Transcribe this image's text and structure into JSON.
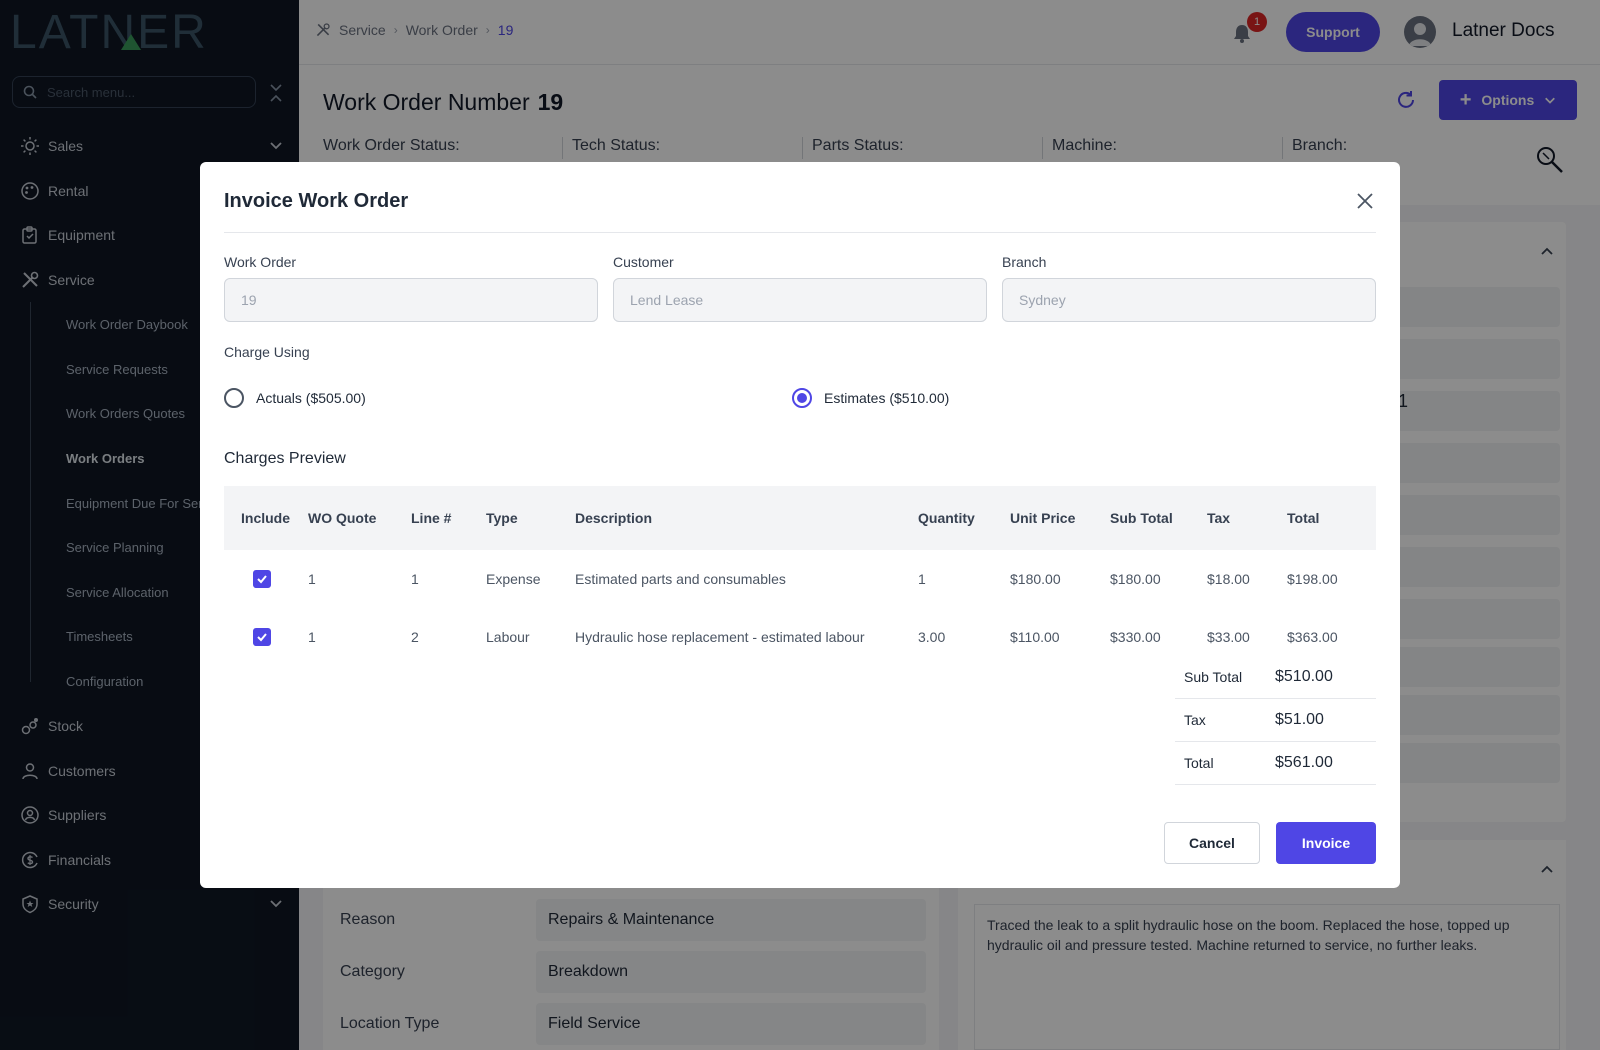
{
  "brand": {
    "logo_text": "LATNER"
  },
  "sidebar": {
    "search_placeholder": "Search menu...",
    "items": [
      {
        "label": "Sales",
        "icon": "sun-icon",
        "expandable": true
      },
      {
        "label": "Rental",
        "icon": "palette-icon"
      },
      {
        "label": "Equipment",
        "icon": "clipboard-icon"
      },
      {
        "label": "Service",
        "icon": "tools-icon"
      }
    ],
    "service_sub": [
      "Work Order Daybook",
      "Service Requests",
      "Work Orders Quotes",
      "Work Orders",
      "Equipment Due For Service",
      "Service Planning",
      "Service Allocation",
      "Timesheets",
      "Configuration"
    ],
    "items_after": [
      {
        "label": "Stock",
        "icon": "boxes-icon"
      },
      {
        "label": "Customers",
        "icon": "user-icon"
      },
      {
        "label": "Suppliers",
        "icon": "supplier-icon"
      },
      {
        "label": "Financials",
        "icon": "dollar-icon"
      },
      {
        "label": "Security",
        "icon": "shield-icon",
        "expandable": true
      }
    ]
  },
  "topbar": {
    "breadcrumb": [
      "Service",
      "Work Order",
      "19"
    ],
    "notifications": "1",
    "support": "Support",
    "user": "Latner Docs"
  },
  "header": {
    "title": "Work Order Number",
    "number": "19",
    "options": "Options",
    "status_labels": [
      "Work Order Status:",
      "Tech Status:",
      "Parts Status:",
      "Machine:",
      "Branch:"
    ]
  },
  "background": {
    "partial_value": "1",
    "reason_label": "Reason",
    "reason_value": "Repairs & Maintenance",
    "category_label": "Category",
    "category_value": "Breakdown",
    "location_label": "Location Type",
    "location_value": "Field Service",
    "notes": "Traced the leak to a split hydraulic hose on the boom. Replaced the hose, topped up hydraulic oil and pressure tested. Machine returned to service, no further leaks."
  },
  "modal": {
    "title": "Invoice Work Order",
    "fields": {
      "work_order_label": "Work Order",
      "work_order_value": "19",
      "customer_label": "Customer",
      "customer_value": "Lend Lease",
      "branch_label": "Branch",
      "branch_value": "Sydney"
    },
    "charge_using": "Charge Using",
    "radio_actuals": "Actuals ($505.00)",
    "radio_estimates": "Estimates ($510.00)",
    "selected": "estimates",
    "preview_label": "Charges Preview",
    "columns": [
      "Include",
      "WO Quote",
      "Line #",
      "Type",
      "Description",
      "Quantity",
      "Unit Price",
      "Sub Total",
      "Tax",
      "Total"
    ],
    "rows": [
      {
        "include": true,
        "wo_quote": "1",
        "line": "1",
        "type": "Expense",
        "description": "Estimated parts and consumables",
        "quantity": "1",
        "unit_price": "$180.00",
        "sub_total": "$180.00",
        "tax": "$18.00",
        "total": "$198.00"
      },
      {
        "include": true,
        "wo_quote": "1",
        "line": "2",
        "type": "Labour",
        "description": "Hydraulic hose replacement - estimated labour",
        "quantity": "3.00",
        "unit_price": "$110.00",
        "sub_total": "$330.00",
        "tax": "$33.00",
        "total": "$363.00"
      }
    ],
    "summary": {
      "sub_total_label": "Sub Total",
      "sub_total": "$510.00",
      "tax_label": "Tax",
      "tax": "$51.00",
      "total_label": "Total",
      "total": "$561.00"
    },
    "cancel": "Cancel",
    "invoice": "Invoice"
  },
  "colors": {
    "accent": "#4f46e5",
    "sidebar_bg": "#0f1724",
    "badge": "#dc2626"
  }
}
